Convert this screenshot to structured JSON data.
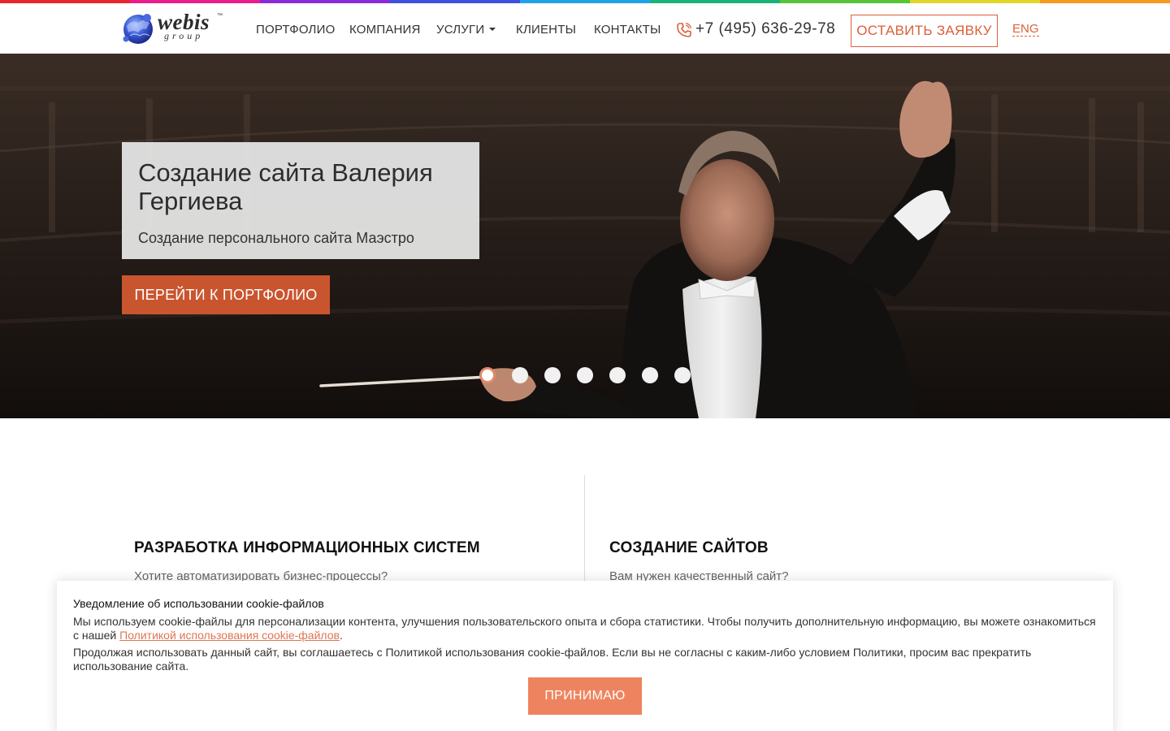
{
  "colors": {
    "accent": "#d9603b",
    "hero_button": "#c9552f",
    "cookie_button": "#ee845f",
    "rainbow": [
      "#e8262b",
      "#e91e8c",
      "#8a2bd8",
      "#3f51e0",
      "#1fa3e8",
      "#19b37a",
      "#58c43a",
      "#e2d629",
      "#f79a1e"
    ]
  },
  "header": {
    "logo": {
      "word": "webis",
      "tm": "™",
      "group": "group"
    },
    "nav": [
      {
        "label": "ПОРТФОЛИО"
      },
      {
        "label": "КОМПАНИЯ"
      },
      {
        "label": "УСЛУГИ",
        "dropdown": true
      },
      {
        "label": "КЛИЕНТЫ"
      },
      {
        "label": "КОНТАКТЫ"
      }
    ],
    "phone_icon": "phone-icon",
    "phone": "+7 (495) 636-29-78",
    "cta_label": "ОСТАВИТЬ ЗАЯВКУ",
    "lang_label": "ENG"
  },
  "hero": {
    "title": "Создание сайта Валерия Гергиева",
    "subtitle": "Создание персонального сайта Маэстро",
    "button_label": "ПЕРЕЙТИ К ПОРТФОЛИО",
    "slides_total": 7,
    "active_slide": 1
  },
  "services": [
    {
      "title": "РАЗРАБОТКА ИНФОРМАЦИОННЫХ СИСТЕМ",
      "text": "Хотите автоматизировать бизнес-процессы?"
    },
    {
      "title": "СОЗДАНИЕ САЙТОВ",
      "text": "Вам нужен качественный сайт?"
    }
  ],
  "cookie": {
    "title": "Уведомление об использовании cookie-файлов",
    "p1_before": "Мы используем cookie-файлы для персонализации контента, улучшения пользовательского опыта и сбора статистики. Чтобы получить дополнительную информацию, вы можете ознакомиться с нашей ",
    "p1_link": "Политикой использования cookie-файлов",
    "p1_after": ".",
    "p2": "Продолжая использовать данный сайт, вы соглашаетесь с Политикой использования cookie-файлов. Если вы не согласны с каким-либо условием Политики, просим вас прекратить использование сайта.",
    "button_label": "ПРИНИМАЮ"
  }
}
